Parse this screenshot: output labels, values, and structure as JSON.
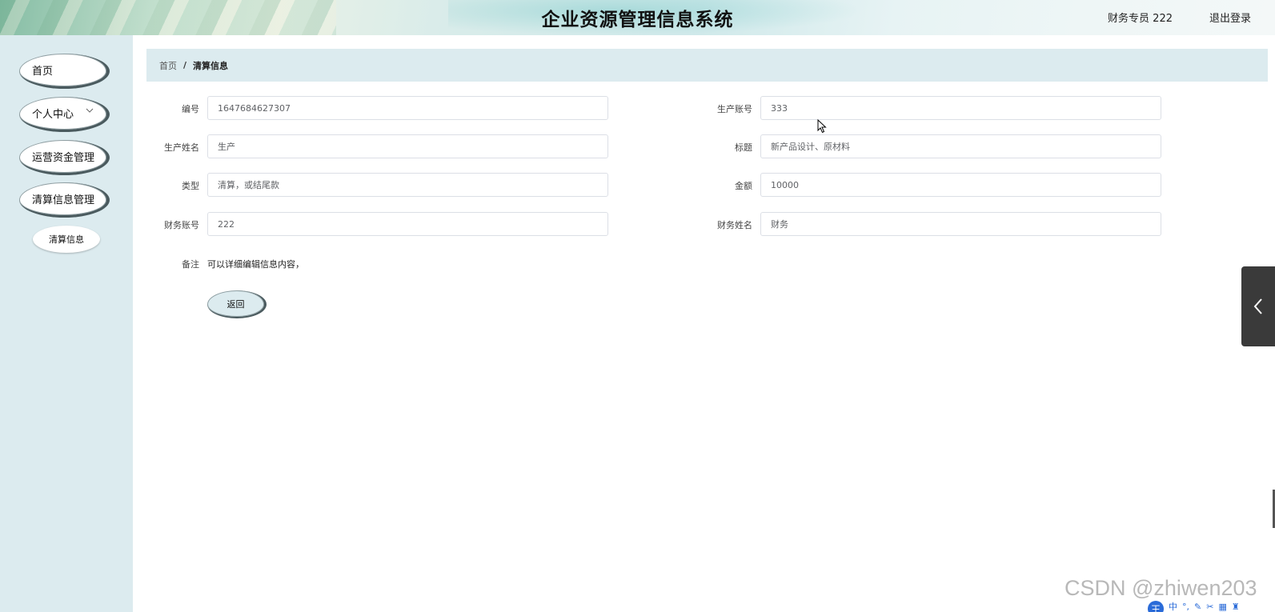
{
  "header": {
    "title": "企业资源管理信息系统",
    "user": "财务专员 222",
    "logout": "退出登录"
  },
  "sidebar": {
    "items": [
      {
        "label": "首页"
      },
      {
        "label": "个人中心"
      },
      {
        "label": "运营资金管理"
      },
      {
        "label": "清算信息管理"
      }
    ],
    "sub_item": "清算信息"
  },
  "breadcrumb": {
    "home": "首页",
    "separator": "/",
    "current": "清算信息"
  },
  "form": {
    "fields": [
      {
        "label": "编号",
        "value": "1647684627307"
      },
      {
        "label": "生产账号",
        "value": "333"
      },
      {
        "label": "生产姓名",
        "value": "生产"
      },
      {
        "label": "标题",
        "value": "新产品设计、原材料"
      },
      {
        "label": "类型",
        "value": "清算，或结尾款"
      },
      {
        "label": "金额",
        "value": "10000"
      },
      {
        "label": "财务账号",
        "value": "222"
      },
      {
        "label": "财务姓名",
        "value": "财务"
      }
    ],
    "remark_label": "备注",
    "remark_value": "可以详细编辑信息内容，",
    "back_button": "返回"
  },
  "watermark": "CSDN @zhiwen203",
  "ime": {
    "logo": "王",
    "mode": "中"
  }
}
